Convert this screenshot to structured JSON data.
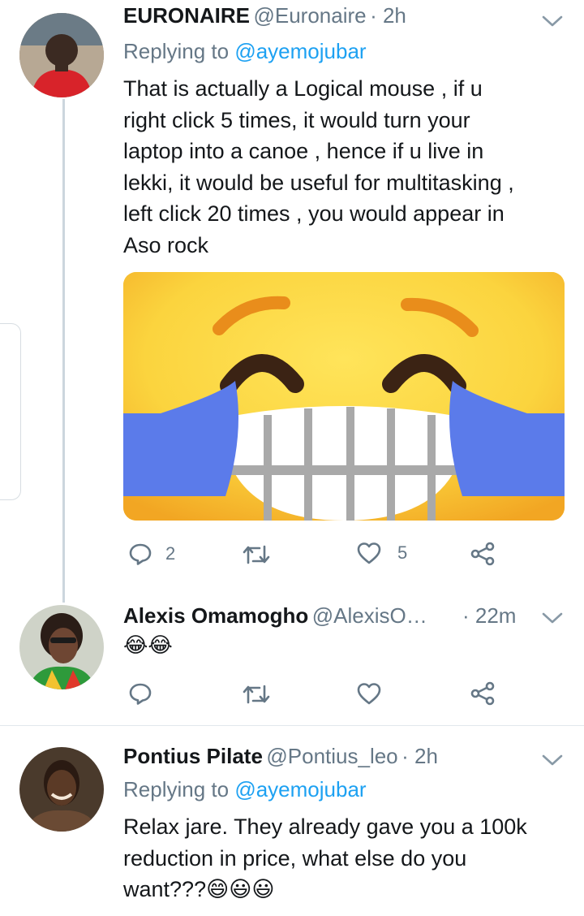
{
  "tweets": [
    {
      "name": "EURONAIRE",
      "handle": "@Euronaire",
      "time": "· 2h",
      "reply_prefix": "Replying to",
      "reply_to": "@ayemojubar",
      "text": "That is actually a Logical mouse , if u\nright click 5 times, it would turn your\nlaptop into a canoe , hence if u live in\nlekki, it would be useful for multitasking ,\nleft click 20 times , you would appear in\nAso rock",
      "replies": "2",
      "retweets": "",
      "likes": "5",
      "media_icon": "face-with-tears-of-joy-emoji"
    },
    {
      "name": "Alexis Omamogho",
      "handle": "@AlexisO…",
      "time": "· 22m",
      "text": "😂😂",
      "replies": "",
      "retweets": "",
      "likes": ""
    },
    {
      "name": "Pontius Pilate",
      "handle": "@Pontius_leo",
      "time": "· 2h",
      "reply_prefix": "Replying to",
      "reply_to": "@ayemojubar",
      "text": "Relax jare.  They already gave you a 100k\nreduction in price, what else do you\nwant???😄😃😃"
    }
  ],
  "colors": {
    "accent": "#1da1f2",
    "secondary_text": "#657786",
    "thread_line": "#ccd6dd",
    "divider": "#e1e8ed"
  }
}
